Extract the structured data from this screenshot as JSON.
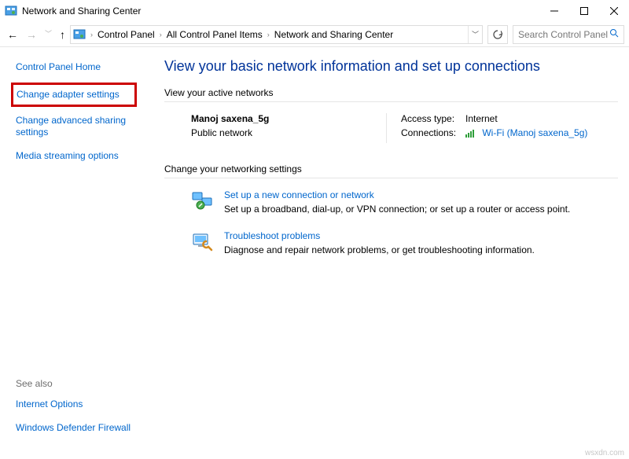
{
  "window": {
    "title": "Network and Sharing Center"
  },
  "breadcrumb": {
    "item1": "Control Panel",
    "item2": "All Control Panel Items",
    "item3": "Network and Sharing Center"
  },
  "search": {
    "placeholder": "Search Control Panel"
  },
  "sidebar": {
    "home": "Control Panel Home",
    "adapter": "Change adapter settings",
    "advanced": "Change advanced sharing settings",
    "media": "Media streaming options",
    "seealso": "See also",
    "internet_options": "Internet Options",
    "firewall": "Windows Defender Firewall"
  },
  "main": {
    "heading": "View your basic network information and set up connections",
    "active_hd": "View your active networks",
    "net_name": "Manoj saxena_5g",
    "net_type": "Public network",
    "access_label": "Access type:",
    "access_value": "Internet",
    "conn_label": "Connections:",
    "conn_link": "Wi-Fi (Manoj saxena_5g)",
    "settings_hd": "Change your networking settings",
    "setup_title": "Set up a new connection or network",
    "setup_desc": "Set up a broadband, dial-up, or VPN connection; or set up a router or access point.",
    "trouble_title": "Troubleshoot problems",
    "trouble_desc": "Diagnose and repair network problems, or get troubleshooting information."
  },
  "watermark": "wsxdn.com"
}
